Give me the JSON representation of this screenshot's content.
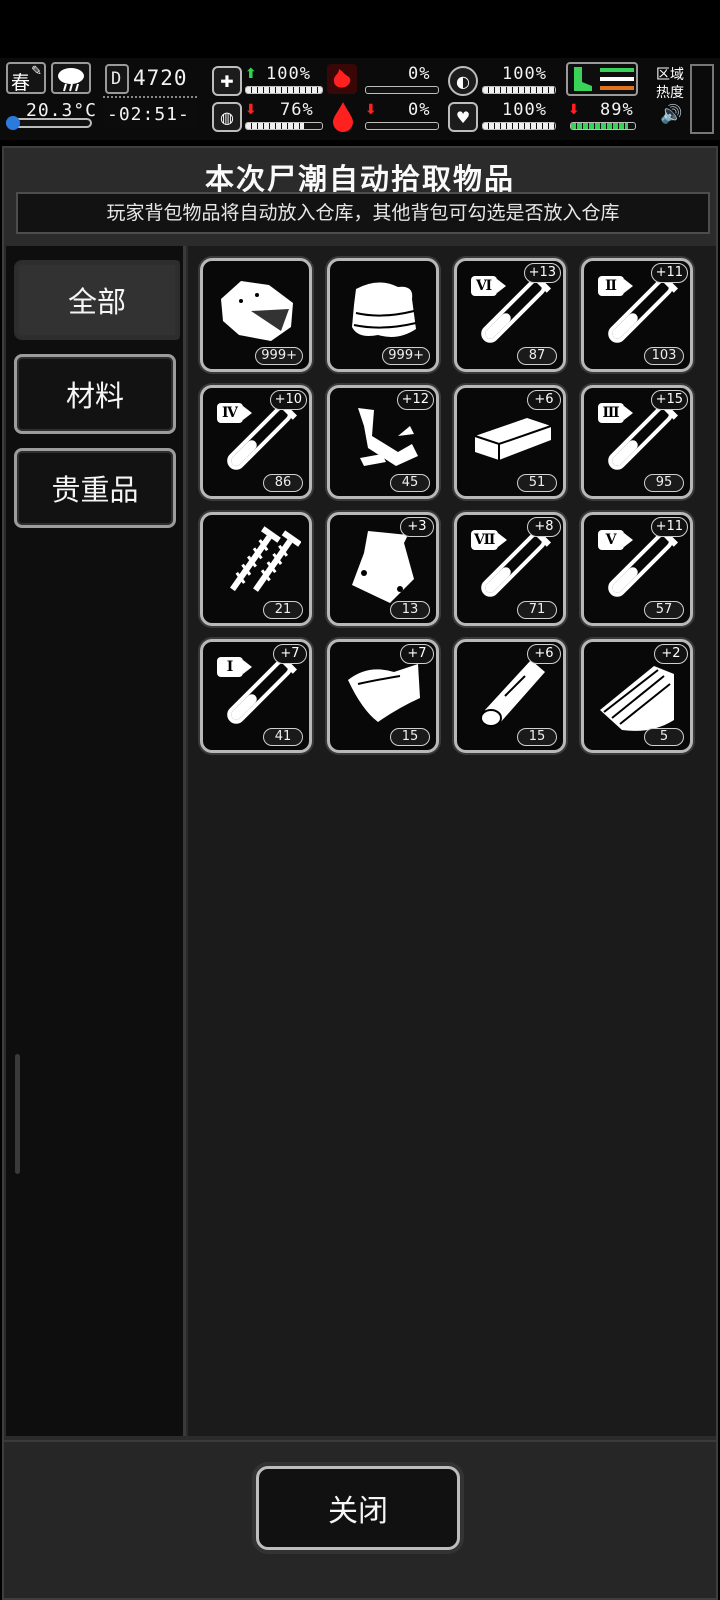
{
  "hud": {
    "season": "春",
    "temperature": "20.3°C",
    "day": "4720",
    "clock": "-02:51-",
    "health": "100%",
    "hunger": "0%",
    "stamina": "100%",
    "sanity": "76%",
    "thirst": "0%",
    "heart": "100%",
    "leg": "89%",
    "zone_heat": "区域\n热度",
    "stat_fill": {
      "health": 1.0,
      "hunger": 0.0,
      "stamina": 1.0,
      "sanity": 0.76,
      "thirst": 0.0,
      "heart": 1.0,
      "leg": 0.89
    },
    "colors": {
      "green": "#39d35a",
      "red": "#ff2020",
      "orange": "#e0731b"
    }
  },
  "dialog": {
    "title": "本次尸潮自动拾取物品",
    "subtitle": "玩家背包物品将自动放入仓库，其他背包可勾选是否放入仓库"
  },
  "tabs": [
    {
      "label": "全部",
      "active": true
    },
    {
      "label": "材料",
      "active": false
    },
    {
      "label": "贵重品",
      "active": false
    }
  ],
  "items": [
    {
      "icon": "meat-chunk-icon",
      "count": "999+",
      "bonus": "",
      "tier": ""
    },
    {
      "icon": "cloth-stack-icon",
      "count": "999+",
      "bonus": "",
      "tier": ""
    },
    {
      "icon": "test-tube-icon",
      "count": "87",
      "bonus": "+13",
      "tier": "Ⅵ"
    },
    {
      "icon": "test-tube-icon",
      "count": "103",
      "bonus": "+11",
      "tier": "Ⅱ"
    },
    {
      "icon": "test-tube-icon",
      "count": "86",
      "bonus": "+10",
      "tier": "Ⅳ"
    },
    {
      "icon": "scrap-parts-icon",
      "count": "45",
      "bonus": "+12",
      "tier": ""
    },
    {
      "icon": "metal-bar-icon",
      "count": "51",
      "bonus": "+6",
      "tier": ""
    },
    {
      "icon": "test-tube-icon",
      "count": "95",
      "bonus": "+15",
      "tier": "Ⅲ"
    },
    {
      "icon": "screws-icon",
      "count": "21",
      "bonus": "",
      "tier": ""
    },
    {
      "icon": "plastic-bag-icon",
      "count": "13",
      "bonus": "+3",
      "tier": ""
    },
    {
      "icon": "test-tube-icon",
      "count": "71",
      "bonus": "+8",
      "tier": "Ⅶ"
    },
    {
      "icon": "test-tube-icon",
      "count": "57",
      "bonus": "+11",
      "tier": "Ⅴ"
    },
    {
      "icon": "test-tube-icon",
      "count": "41",
      "bonus": "+7",
      "tier": "Ⅰ"
    },
    {
      "icon": "leather-sheet-icon",
      "count": "15",
      "bonus": "+7",
      "tier": ""
    },
    {
      "icon": "wood-log-icon",
      "count": "15",
      "bonus": "+6",
      "tier": ""
    },
    {
      "icon": "wood-planks-icon",
      "count": "5",
      "bonus": "+2",
      "tier": ""
    }
  ],
  "footer": {
    "close_label": "关闭"
  }
}
